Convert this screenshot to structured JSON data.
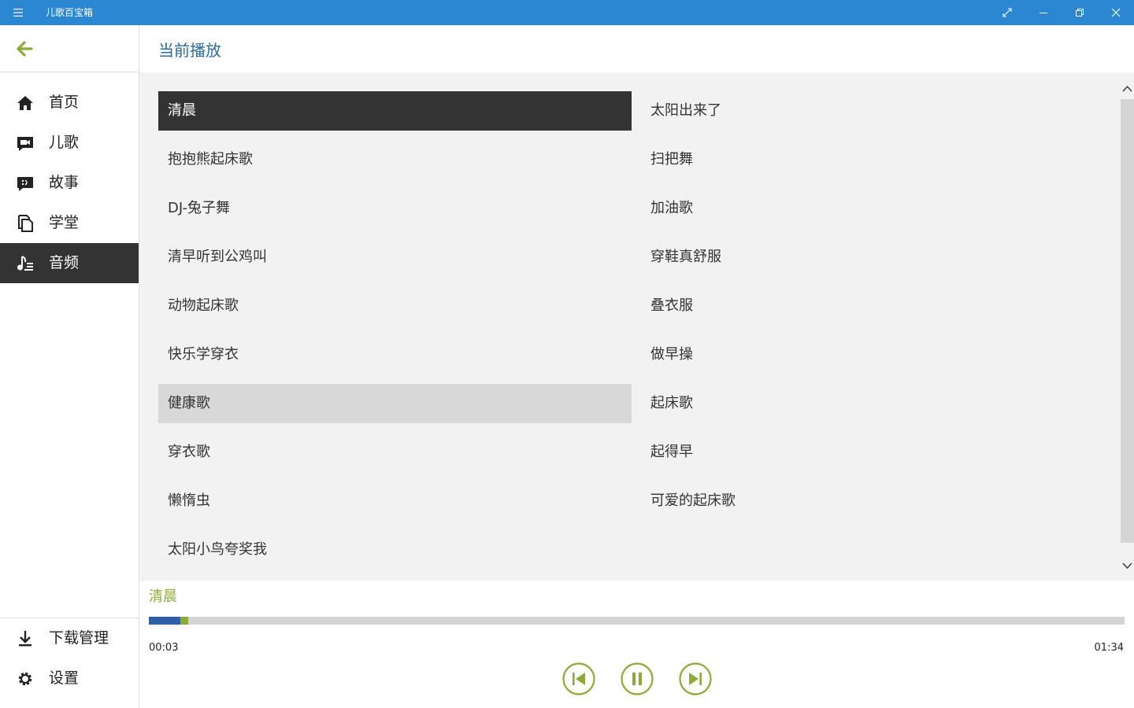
{
  "app": {
    "title": "儿歌百宝箱"
  },
  "sidebar": {
    "items": [
      {
        "label": "首页",
        "icon": "home-icon"
      },
      {
        "label": "儿歌",
        "icon": "video-chat-icon"
      },
      {
        "label": "故事",
        "icon": "story-chat-icon"
      },
      {
        "label": "学堂",
        "icon": "documents-icon"
      },
      {
        "label": "音频",
        "icon": "music-list-icon",
        "active": true
      }
    ],
    "bottom_items": [
      {
        "label": "下载管理",
        "icon": "download-icon"
      },
      {
        "label": "设置",
        "icon": "gear-icon"
      }
    ]
  },
  "header": {
    "title": "当前播放"
  },
  "playlist": {
    "left": [
      "清晨",
      "抱抱熊起床歌",
      "DJ-兔子舞",
      "清早听到公鸡叫",
      "动物起床歌",
      "快乐学穿衣",
      "健康歌",
      "穿衣歌",
      "懒惰虫",
      "太阳小鸟夸奖我"
    ],
    "right": [
      "太阳出来了",
      "扫把舞",
      "加油歌",
      "穿鞋真舒服",
      "叠衣服",
      "做早操",
      "起床歌",
      "起得早",
      "可爱的起床歌"
    ],
    "playing": "清晨",
    "highlighted": "健康歌"
  },
  "player": {
    "current_title": "清晨",
    "current_time": "00:03",
    "total_time": "01:34",
    "progress_fraction": 0.032,
    "colors": {
      "accent": "#8bab34",
      "played": "#2f5fa6",
      "titlebar": "#2b87d1",
      "active_bg": "#333333"
    }
  }
}
